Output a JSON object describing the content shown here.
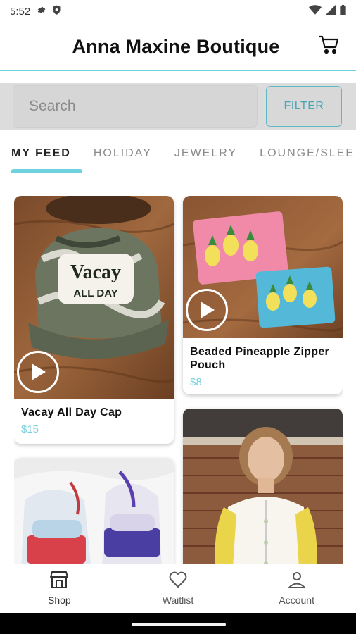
{
  "status_bar": {
    "time": "5:52"
  },
  "header": {
    "title": "Anna Maxine Boutique"
  },
  "search": {
    "placeholder": "Search",
    "filter_label": "FILTER"
  },
  "tabs": [
    {
      "label": "MY FEED",
      "active": true
    },
    {
      "label": "HOLIDAY",
      "active": false
    },
    {
      "label": "JEWELRY",
      "active": false
    },
    {
      "label": "LOUNGE/SLEE",
      "active": false
    }
  ],
  "products": [
    {
      "name": "Vacay All Day Cap",
      "price": "$15",
      "image_text_1": "Vacay",
      "image_text_2": "ALL DAY",
      "has_video": true
    },
    {
      "name": "Beaded Pineapple Zipper Pouch",
      "price": "$8",
      "has_video": true
    },
    {
      "name": "",
      "price": "",
      "has_video": false
    },
    {
      "name": "",
      "price": "",
      "has_video": false
    }
  ],
  "bottom_nav": [
    {
      "label": "Shop",
      "icon": "shop-icon"
    },
    {
      "label": "Waitlist",
      "icon": "heart-icon"
    },
    {
      "label": "Account",
      "icon": "person-icon"
    }
  ],
  "colors": {
    "accent": "#6fd3df",
    "price": "#7cd0dc",
    "filter_border": "#5fb8c6"
  }
}
